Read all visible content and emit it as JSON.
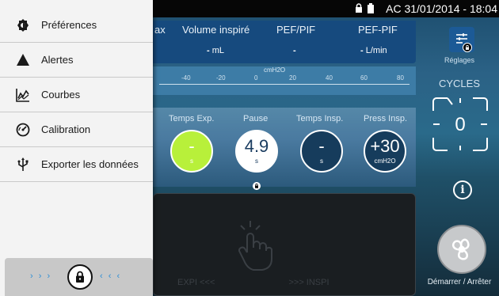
{
  "status_bar": {
    "text": "AC 31/01/2014 - 18:04"
  },
  "measures": {
    "partial_label": "ax",
    "items": [
      {
        "label": "Volume inspiré",
        "value": "-",
        "unit": "mL"
      },
      {
        "label": "PEF/PIF",
        "value": "-",
        "unit": ""
      },
      {
        "label": "PEF-PIF",
        "value": "-",
        "unit": "L/min"
      }
    ]
  },
  "ruler": {
    "unit": "cmH2O",
    "ticks": [
      "-40",
      "-20",
      "0",
      "20",
      "40",
      "60",
      "80"
    ]
  },
  "params": {
    "items": [
      {
        "label": "Temps Exp.",
        "value": "-",
        "unit": "s",
        "color": "#b8f03a",
        "text_color": "#ffffff"
      },
      {
        "label": "Pause",
        "value": "4.9",
        "unit": "s",
        "color": "#ffffff",
        "text_color": "#1a3c60"
      },
      {
        "label": "Temps Insp.",
        "value": "-",
        "unit": "s",
        "color": "#163c5c",
        "text_color": "#ffffff"
      },
      {
        "label": "Press Insp.",
        "value": "+30",
        "unit": "cmH2O",
        "color": "#163c5c",
        "text_color": "#ffffff"
      }
    ]
  },
  "waveform": {
    "expi_label": "EXPI <<<",
    "inspi_label": ">>> INSPI"
  },
  "right_panel": {
    "reglages_label": "Réglages",
    "cycles_label": "CYCLES",
    "cycles_value": "0",
    "start_stop_label": "Démarrer / Arrêter"
  },
  "drawer": {
    "items": [
      {
        "label": "Préférences",
        "icon": "gear-icon"
      },
      {
        "label": "Alertes",
        "icon": "alert-triangle-icon"
      },
      {
        "label": "Courbes",
        "icon": "chart-curve-icon"
      },
      {
        "label": "Calibration",
        "icon": "gauge-icon"
      },
      {
        "label": "Exporter les données",
        "icon": "usb-icon"
      }
    ],
    "lock_left_chevrons": "› › ›",
    "lock_right_chevrons": "‹ ‹ ‹"
  },
  "colors": {
    "accent_blue": "#2f8fd6",
    "drawer_bg": "#f3f3f3",
    "measure_panel": "#164a7e"
  }
}
